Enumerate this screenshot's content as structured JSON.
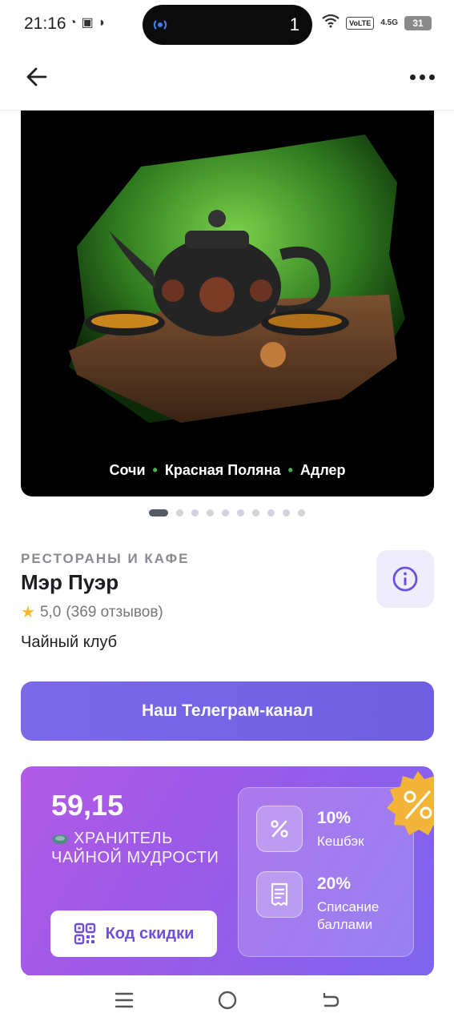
{
  "status_bar": {
    "time": "21:16",
    "island_number": "1",
    "volte": "VoLTE",
    "signal": "4.5G",
    "battery": "31"
  },
  "app_bar": {
    "back_icon": "arrow-left-icon",
    "more_icon": "more-horizontal-icon"
  },
  "hero": {
    "cities": [
      "Сочи",
      "Красная Поляна",
      "Адлер"
    ],
    "separator": "•",
    "slides_total": 10,
    "active_slide": 1
  },
  "place": {
    "category": "РЕСТОРАНЫ И КАФЕ",
    "name": "Мэр Пуэр",
    "rating": "5,0",
    "reviews": "(369 отзывов)",
    "description": "Чайный клуб"
  },
  "telegram_button": {
    "label": "Наш Телеграм-канал"
  },
  "loyalty": {
    "points": "59,15",
    "level": "ХРАНИТЕЛЬ ЧАЙНОЙ МУДРОСТИ",
    "discount_button": "Код скидки",
    "perks": [
      {
        "value": "10%",
        "label": "Кешбэк",
        "icon": "percent-icon"
      },
      {
        "value": "20%",
        "label": "Списание баллами",
        "icon": "receipt-icon"
      }
    ]
  },
  "colors": {
    "accent": "#7b69ea",
    "card_gradient_start": "#b15be6",
    "card_gradient_end": "#7d65ee",
    "star": "#f5b82e"
  }
}
